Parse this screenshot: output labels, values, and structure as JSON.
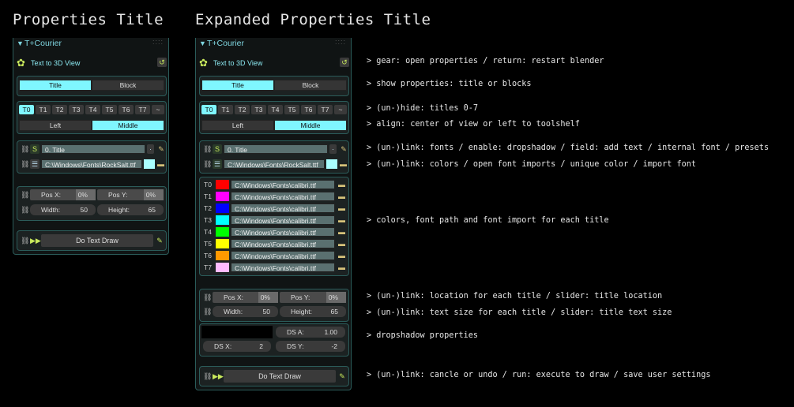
{
  "titles": {
    "left": "Properties Title",
    "right": "Expanded Properties Title"
  },
  "panel": {
    "header": "T+Courier",
    "addon_label": "Text to 3D View",
    "tab_title": "Title",
    "tab_block": "Block",
    "tabs": [
      "T0",
      "T1",
      "T2",
      "T3",
      "T4",
      "T5",
      "T6",
      "T7",
      "~"
    ],
    "align_left": "Left",
    "align_middle": "Middle",
    "title_field": "0. Title",
    "font_path": "C:\\Windows\\Fonts\\RockSalt.ttf",
    "pos_x_label": "Pos X:",
    "pos_x_value": "0%",
    "pos_y_label": "Pos Y:",
    "pos_y_value": "0%",
    "width_label": "Width:",
    "width_value": "50",
    "height_label": "Height:",
    "height_value": "65",
    "draw_button": "Do Text Draw",
    "ds_a_label": "DS A:",
    "ds_a_value": "1.00",
    "ds_x_label": "DS X:",
    "ds_x_value": "2",
    "ds_y_label": "DS Y:",
    "ds_y_value": "-2",
    "title_rows": [
      {
        "label": "T0",
        "color": "#ff0000",
        "path": "C:\\Windows\\Fonts\\calibri.ttf"
      },
      {
        "label": "T1",
        "color": "#ff00ff",
        "path": "C:\\Windows\\Fonts\\calibri.ttf"
      },
      {
        "label": "T2",
        "color": "#0000ff",
        "path": "C:\\Windows\\Fonts\\calibri.ttf"
      },
      {
        "label": "T3",
        "color": "#00ffff",
        "path": "C:\\Windows\\Fonts\\calibri.ttf"
      },
      {
        "label": "T4",
        "color": "#00ff00",
        "path": "C:\\Windows\\Fonts\\calibri.ttf"
      },
      {
        "label": "T5",
        "color": "#ffff00",
        "path": "C:\\Windows\\Fonts\\calibri.ttf"
      },
      {
        "label": "T6",
        "color": "#ff9900",
        "path": "C:\\Windows\\Fonts\\calibri.ttf"
      },
      {
        "label": "T7",
        "color": "#ffbbff",
        "path": "C:\\Windows\\Fonts\\calibri.ttf"
      }
    ]
  },
  "notes": [
    "> gear: open properties / return: restart blender",
    "> show properties: title or blocks",
    "> (un-)hide: titles 0-7",
    "> align: center of view or left to toolshelf",
    "> (un-)link: fonts / enable: dropshadow / field: add text / internal font / presets",
    "> (un-)link: colors / open font imports / unique color / import font",
    "> colors, font path and font import for each title",
    "> (un-)link: location for each title / slider: title location",
    "> (un-)link: text size for each title / slider: title text size",
    "> dropshadow properties",
    "> (un-)link: cancle or undo / run: execute to draw / save user settings"
  ],
  "colors": {
    "accent": "#7ff6ff",
    "field": "#5a7070",
    "border": "#2b5c5a"
  }
}
